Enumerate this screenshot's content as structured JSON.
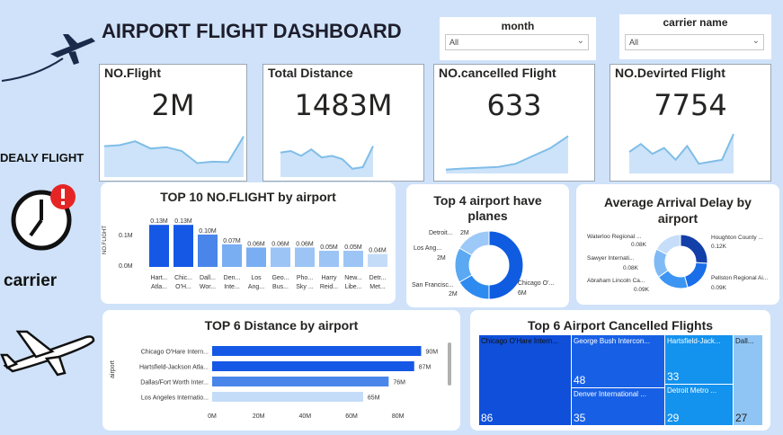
{
  "header": {
    "title": "AIRPORT FLIGHT DASHBOARD"
  },
  "sidebar": {
    "delay_label": "DEALY FLIGHT",
    "carrier_label": "carrier"
  },
  "slicers": [
    {
      "label": "month",
      "value": "All"
    },
    {
      "label": "carrier name",
      "value": "All"
    }
  ],
  "kpis": [
    {
      "title": "NO.Flight",
      "value": "2M",
      "spark": [
        0.6,
        0.62,
        0.7,
        0.55,
        0.58,
        0.5,
        0.25,
        0.28,
        0.27,
        0.8
      ]
    },
    {
      "title": "Total Distance",
      "value": "1483M",
      "spark": [
        0.7,
        0.75,
        0.6,
        0.8,
        0.55,
        0.6,
        0.5,
        0.2,
        0.25,
        0.9
      ]
    },
    {
      "title": "NO.cancelled Flight",
      "value": "633",
      "spark": [
        0.05,
        0.08,
        0.1,
        0.12,
        0.2,
        0.4,
        0.6,
        0.9
      ]
    },
    {
      "title": "NO.Devirted Flight",
      "value": "7754",
      "spark": [
        0.5,
        0.7,
        0.45,
        0.6,
        0.3,
        0.65,
        0.2,
        0.25,
        0.3,
        0.95
      ]
    }
  ],
  "chart_data": [
    {
      "type": "bar",
      "title": "TOP 10 NO.FLIGHT by airport",
      "ylabel": "NO.FLIGHT",
      "yticks": [
        "0.1M",
        "0.0M"
      ],
      "ylim": [
        0,
        0.15
      ],
      "categories_l1": [
        "Hart...",
        "Chic...",
        "Dall...",
        "Den...",
        "Los",
        "Geo...",
        "Pho...",
        "Harry",
        "New...",
        "Detr..."
      ],
      "categories_l2": [
        "Atla...",
        "O'H...",
        "Wor...",
        "Inte...",
        "Ang...",
        "Bus...",
        "Sky ...",
        "Reid...",
        "Libe...",
        "Met..."
      ],
      "values": [
        0.13,
        0.13,
        0.1,
        0.07,
        0.06,
        0.06,
        0.06,
        0.05,
        0.05,
        0.04
      ],
      "value_labels": [
        "0.13M",
        "0.13M",
        "0.10M",
        "0.07M",
        "0.06M",
        "0.06M",
        "0.06M",
        "0.05M",
        "0.05M",
        "0.04M"
      ]
    },
    {
      "type": "pie",
      "title": "Top 4 airport have planes",
      "labels": [
        "Chicago O'...",
        "San Francisc...",
        "Los Ang...",
        "Detroit..."
      ],
      "value_labels": [
        "6M",
        "2M",
        "2M",
        "2M"
      ],
      "values": [
        6,
        2,
        2,
        2
      ]
    },
    {
      "type": "pie",
      "title": "Average Arrival Delay by airport",
      "labels": [
        "Houghton County ...",
        "Pellston Regional Ai...",
        "Abraham Lincoln Ca...",
        "Sawyer Internati...",
        "Waterloo Regional ..."
      ],
      "value_labels": [
        "0.12K",
        "0.09K",
        "0.09K",
        "0.08K",
        "0.08K"
      ],
      "values": [
        0.12,
        0.09,
        0.09,
        0.08,
        0.08
      ]
    },
    {
      "type": "bar",
      "title": "TOP 6 Distance by airport",
      "ylabel": "airport",
      "categories": [
        "Chicago O'Hare Intern...",
        "Hartsfield-Jackson Atla...",
        "Dallas/Fort Worth Inter...",
        "Los Angeles Internatio..."
      ],
      "values": [
        90,
        87,
        76,
        65
      ],
      "value_labels": [
        "90M",
        "87M",
        "76M",
        "65M"
      ],
      "xticks": [
        "0M",
        "20M",
        "40M",
        "60M",
        "80M"
      ],
      "xlim": [
        0,
        90
      ]
    },
    {
      "type": "heatmap",
      "title": "Top 6 Airport Cancelled Flights",
      "labels": [
        "Chicago O'Hare Intern...",
        "George Bush Intercon...",
        "Denver International ...",
        "Hartsfield-Jack...",
        "Detroit Metro ...",
        "Dall..."
      ],
      "values": [
        86,
        48,
        35,
        33,
        29,
        27
      ]
    }
  ],
  "colors": {
    "bg": "#cfe2f9",
    "dark_blue": "#0f5ce0",
    "mid_blue": "#2d8bf0",
    "light_blue": "#8ec4f6",
    "pale_blue": "#c9def9"
  }
}
